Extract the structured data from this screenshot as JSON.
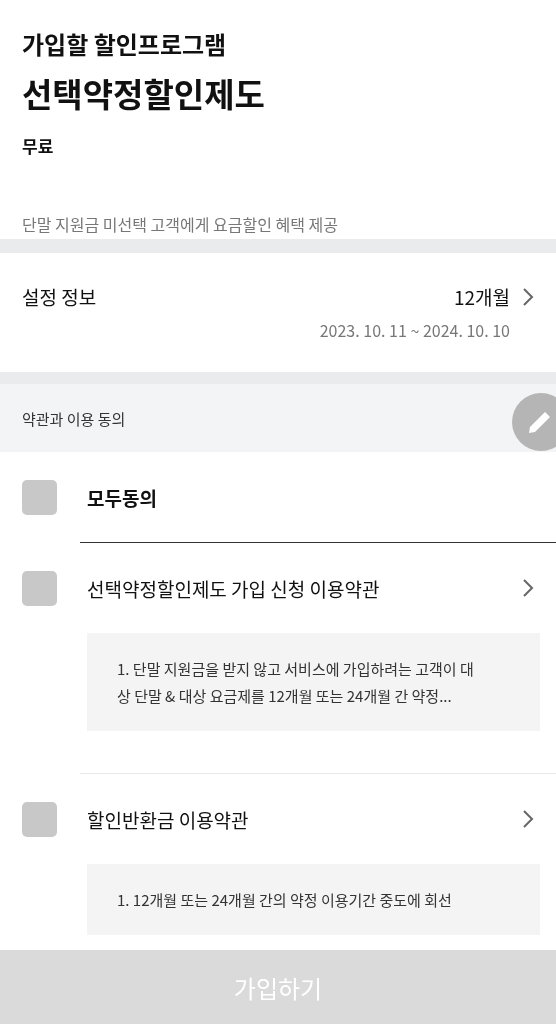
{
  "header": {
    "subtitle": "가입할 할인프로그램",
    "title": "선택약정할인제도",
    "price": "무료",
    "description": "단말 지원금 미선택 고객에게 요금할인 혜택 제공"
  },
  "settings": {
    "label": "설정 정보",
    "value": "12개월",
    "period": "2023. 10. 11 ~ 2024. 10. 10"
  },
  "agreement": {
    "heading": "약관과 이용 동의",
    "items": [
      {
        "kind": "all",
        "label": "모두동의",
        "checked": false
      },
      {
        "kind": "terms",
        "label": "선택약정할인제도 가입 신청 이용약관",
        "checked": false,
        "preview": "1. 단말 지원금을 받지 않고 서비스에 가입하려는 고객이 대상 단말 & 대상 요금제를 12개월 또는 24개월 간 약정..."
      },
      {
        "kind": "terms",
        "label": "할인반환금 이용약관",
        "checked": false,
        "preview": "1. 12개월 또는 24개월 간의 약정 이용기간 중도에 회선"
      }
    ]
  },
  "submit_button": {
    "label": "가입하기",
    "disabled": true
  }
}
